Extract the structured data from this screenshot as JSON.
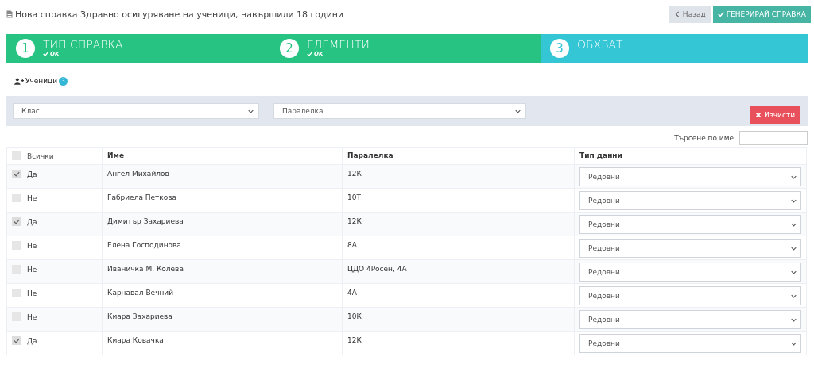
{
  "header": {
    "title": "Нова справка Здравно осигуряване на ученици, навършили 18 години",
    "buttons": [
      {
        "kind": "back",
        "label": "Назад"
      },
      {
        "kind": "primary",
        "label": "ГЕНЕРИРАЙ СПРАВКА"
      }
    ]
  },
  "steps": [
    {
      "number": "1",
      "title": "ТИП СПРАВКА",
      "status": "OK",
      "done": true
    },
    {
      "number": "2",
      "title": "ЕЛЕМЕНТИ",
      "status": "OK",
      "done": true
    },
    {
      "number": "3",
      "title": "ОБХВАТ",
      "done": false
    }
  ],
  "tabs": [
    {
      "label": "Ученици",
      "badge": "3",
      "selected": true
    }
  ],
  "filters": {
    "selects": [
      {
        "placeholder": "Клас"
      },
      {
        "placeholder": "Паралелка"
      }
    ],
    "clear_button": "Изчисти"
  },
  "search": {
    "label": "Търсене по име:"
  },
  "table": {
    "columns": [
      "Всички",
      "Име",
      "Паралелка",
      "Тип данни"
    ],
    "all_checked": false,
    "rows": [
      {
        "checked": true,
        "answer": "Да",
        "name": "Ангел Михайлов",
        "class": "12К",
        "data_type": "Редовни"
      },
      {
        "checked": false,
        "answer": "Не",
        "name": "Габриела Петкова",
        "class": "10Т",
        "data_type": "Редовни"
      },
      {
        "checked": true,
        "answer": "Да",
        "name": "Димитър Захариева",
        "class": "12К",
        "data_type": "Редовни"
      },
      {
        "checked": false,
        "answer": "Не",
        "name": "Елена Господинова",
        "class": "8А",
        "data_type": "Редовни"
      },
      {
        "checked": false,
        "answer": "Не",
        "name": "Иваничка М. Колева",
        "class": "ЦДО 4Росен, 4А",
        "data_type": "Редовни"
      },
      {
        "checked": false,
        "answer": "Не",
        "name": "Карнавал Вечний",
        "class": "4А",
        "data_type": "Редовни"
      },
      {
        "checked": false,
        "answer": "Не",
        "name": "Киара Захариева",
        "class": "10К",
        "data_type": "Редовни"
      },
      {
        "checked": true,
        "answer": "Да",
        "name": "Киара Ковачка",
        "class": "12К",
        "data_type": "Редовни"
      }
    ]
  }
}
